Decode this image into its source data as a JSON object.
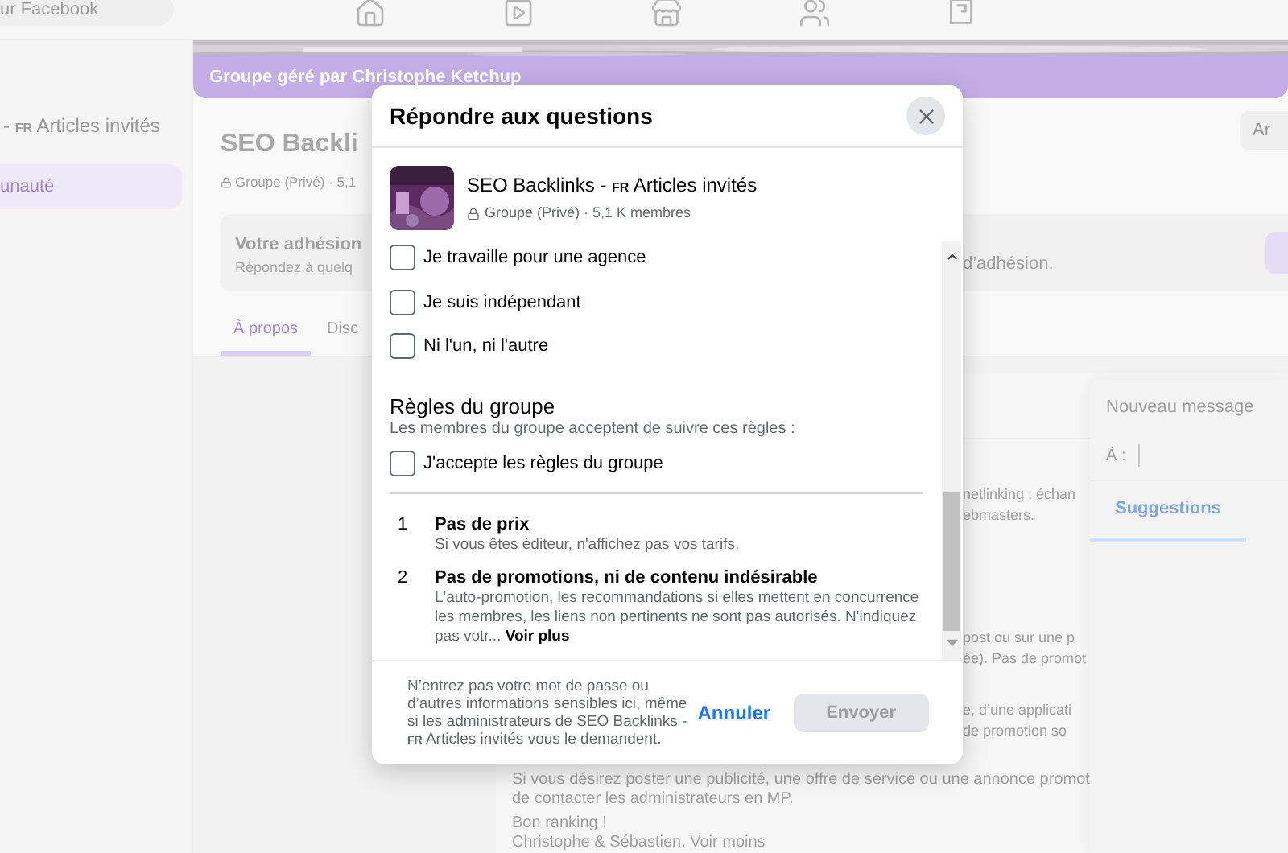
{
  "top_bar": {
    "search": {
      "placeholder": "ur Facebook"
    },
    "nav_icons": [
      {
        "kind": "home"
      },
      {
        "kind": "video"
      },
      {
        "kind": "store"
      },
      {
        "kind": "groups"
      },
      {
        "kind": "gaming"
      }
    ]
  },
  "sidebar": {
    "group_name": {
      "prefix": "-",
      "flag": "FR",
      "suffix": "Articles invités"
    },
    "items": [
      {
        "label": "unauté",
        "selected": true
      }
    ]
  },
  "group_header": {
    "admin_banner": "Groupe géré par Christophe Ketchup",
    "title": "SEO Backli",
    "meta": "Groupe (Privé) · 5,1",
    "action_button": "Ar"
  },
  "membership_card": {
    "title": "Votre adhésion",
    "subtitle": "Répondez à quelq",
    "subtitle_end": "d’adhésion."
  },
  "tabs": [
    {
      "label": "À propos",
      "selected": true
    },
    {
      "label": "Disc",
      "selected": false
    }
  ],
  "about_text": {
    "fragments": [
      [
        "netlinking : échan",
        "ebmasters."
      ],
      [
        "post ou sur une p",
        "ée). Pas de promot"
      ],
      [
        "e, d’une applicati",
        "de promotion so"
      ]
    ],
    "lines": [
      "Si vous désirez poster une publicité, une offre de service ou une annonce promot",
      "de contacter les administrateurs en MP.",
      "Bon ranking !",
      "Christophe & Sébastien. Voir moins"
    ]
  },
  "messenger": {
    "title": "Nouveau message",
    "to_label": "À :",
    "tabs": [
      {
        "label": "Suggestions",
        "selected": true
      }
    ]
  },
  "dialog": {
    "title": "Répondre aux questions",
    "group": {
      "name_prefix": "SEO Backlinks -",
      "flag": "FR",
      "name_suffix": "Articles invités",
      "meta": "Groupe (Privé) · 5,1 K membres"
    },
    "options": [
      {
        "label": "Je travaille pour une agence",
        "checked": false
      },
      {
        "label": "Je suis indépendant",
        "checked": false
      },
      {
        "label": "Ni l'un, ni l'autre",
        "checked": false
      }
    ],
    "rules_title": "Règles du groupe",
    "rules_subtitle": "Les membres du groupe acceptent de suivre ces règles :",
    "accept": {
      "label": "J'accepte les règles du groupe",
      "checked": false
    },
    "rules": [
      {
        "number": "1",
        "title": "Pas de prix",
        "description": "Si vous êtes éditeur, n'affichez pas vos tarifs."
      },
      {
        "number": "2",
        "title": "Pas de promotions, ni de contenu indésirable",
        "description": "L'auto-promotion, les recommandations si elles mettent en concurrence les membres, les liens non pertinents ne sont pas autorisés. N'indiquez pas votr...",
        "more": "Voir plus"
      }
    ],
    "disclaimer": {
      "before": "N’entrez pas votre mot de passe ou d’autres informations sensibles ici, même si les administrateurs de SEO Backlinks -",
      "flag": "FR",
      "after": "Articles invités vous le demandent."
    },
    "cancel": "Annuler",
    "submit": {
      "label": "Envoyer",
      "disabled": true
    }
  }
}
